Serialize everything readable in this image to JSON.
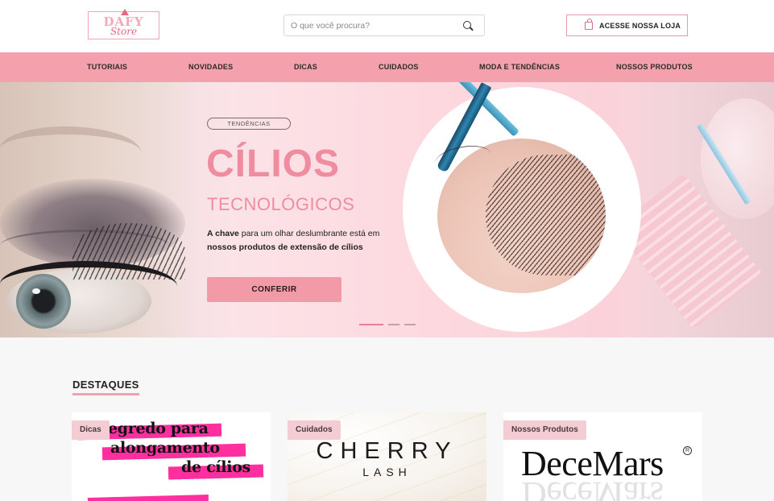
{
  "header": {
    "logo_top": "DAFY",
    "logo_bottom": "Store",
    "search_placeholder": "O que você procura?",
    "store_button": "ACESSE NOSSA LOJA"
  },
  "nav": {
    "items": [
      "TUTORIAIS",
      "NOVIDADES",
      "DICAS",
      "CUIDADOS",
      "MODA E TENDÊNCIAS",
      "NOSSOS PRODUTOS"
    ]
  },
  "hero": {
    "tag": "TENDÊNCIAS",
    "title": "CÍLIOS",
    "subtitle": "TECNOLÓGICOS",
    "desc_bold1": "A chave",
    "desc_mid": " para um olhar deslumbrante está em ",
    "desc_bold2": "nossos produtos de extensão de cílios",
    "cta": "CONFERIR",
    "slides": 3,
    "active_slide": 1
  },
  "featured": {
    "title": "DESTAQUES",
    "cards": [
      {
        "category": "Dicas",
        "headline_line1": "O segredo para",
        "headline_line2": "alongamento",
        "headline_line3": "de cílios"
      },
      {
        "category": "Cuidados",
        "brand": "CHERRY",
        "brand_sub": "LASH"
      },
      {
        "category": "Nossos Produtos",
        "brand": "DeceMars",
        "registered": "R"
      }
    ]
  },
  "colors": {
    "nav_bg": "#f4a1ad",
    "accent_pink": "#ef8c9f",
    "cta_bg": "#f29aa8",
    "badge_bg": "#f3cdd3",
    "magazine_pink": "#ff2fa0"
  }
}
